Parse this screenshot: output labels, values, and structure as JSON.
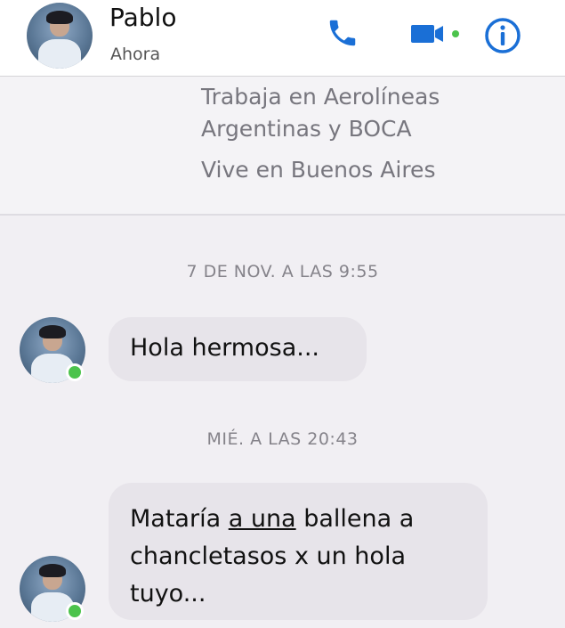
{
  "header": {
    "contact_name": "Pablo",
    "status": "Ahora",
    "icons": [
      "phone-icon",
      "video-icon",
      "info-icon"
    ],
    "accent_color": "#1a6fd6"
  },
  "profile": {
    "line1": "Trabaja en Aerolíneas",
    "line2": "Argentinas y BOCA",
    "line3": "Vive en Buenos Aires"
  },
  "conversation": {
    "timestamp1": "7 DE NOV. A LAS 9:55",
    "message1": "Hola hermosa...",
    "timestamp2": "MIÉ. A LAS 20:43",
    "message2": {
      "part1": "Mataría ",
      "underlined": "a una",
      "part2": " ballena a chancletasos x un hola tuyo..."
    },
    "online_color": "#4cc34c"
  }
}
